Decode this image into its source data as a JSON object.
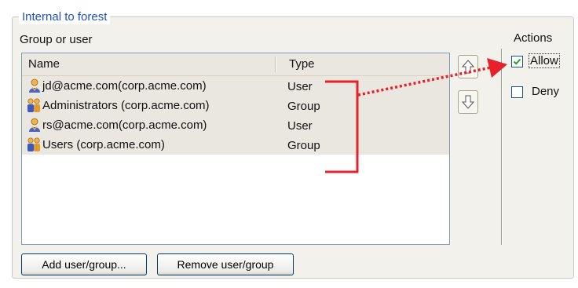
{
  "groupbox": {
    "legend": "Internal to forest"
  },
  "principals": {
    "label": "Group or user",
    "columns": {
      "name": "Name",
      "type": "Type"
    },
    "rows": [
      {
        "name": "jd@acme.com(corp.acme.com)",
        "type": "User",
        "icon": "user-icon"
      },
      {
        "name": "Administrators (corp.acme.com)",
        "type": "Group",
        "icon": "group-icon"
      },
      {
        "name": "rs@acme.com(corp.acme.com)",
        "type": "User",
        "icon": "user-icon"
      },
      {
        "name": "Users (corp.acme.com)",
        "type": "Group",
        "icon": "group-icon"
      }
    ]
  },
  "move_buttons": {
    "up_icon": "arrow-up-icon",
    "down_icon": "arrow-down-icon"
  },
  "actions": {
    "title": "Actions",
    "allow": {
      "label": "Allow",
      "checked": true
    },
    "deny": {
      "label": "Deny",
      "checked": false
    }
  },
  "buttons": {
    "add": "Add user/group...",
    "remove": "Remove user/group"
  },
  "annotation_color": "#e8202a"
}
